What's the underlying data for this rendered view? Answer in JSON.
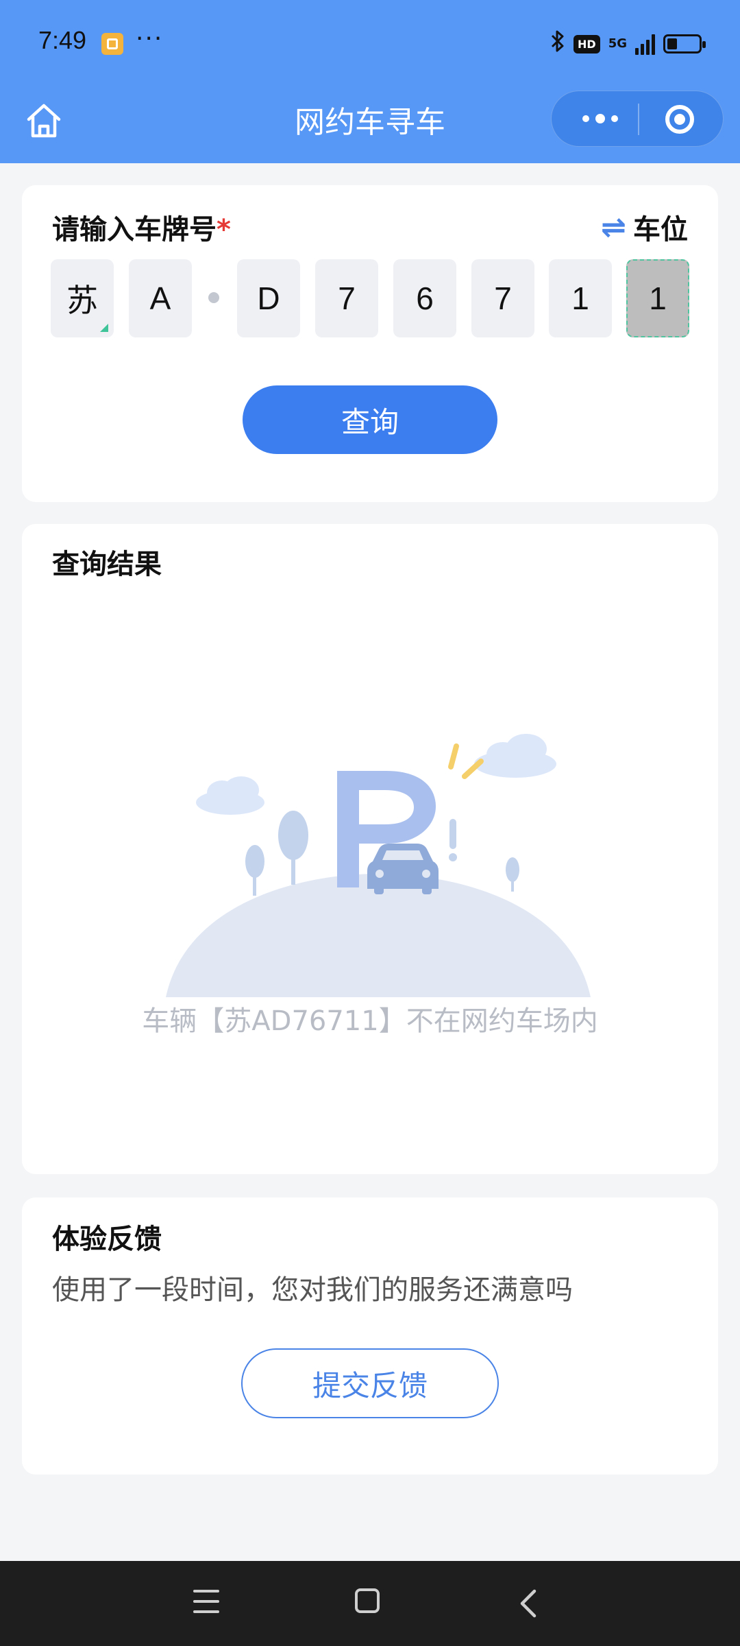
{
  "status_bar": {
    "time": "7:49",
    "hd": "HD",
    "network": "5G",
    "signal_bars": 4,
    "battery_level": 0.35
  },
  "header": {
    "title": "网约车寻车",
    "background": "#5797f5"
  },
  "search": {
    "label": "请输入车牌号",
    "required_mark": "*",
    "switch_label": "车位",
    "plate_chars": [
      "苏",
      "A",
      "D",
      "7",
      "6",
      "7",
      "1",
      "1"
    ],
    "query_button": "查询"
  },
  "result": {
    "title": "查询结果",
    "message": "车辆【苏AD76711】不在网约车场内"
  },
  "feedback": {
    "title": "体验反馈",
    "subtitle": "使用了一段时间，您对我们的服务还满意吗",
    "button": "提交反馈"
  },
  "colors": {
    "accent": "#3c7ef0",
    "required": "#e53935",
    "active_border": "#4fc49e"
  }
}
